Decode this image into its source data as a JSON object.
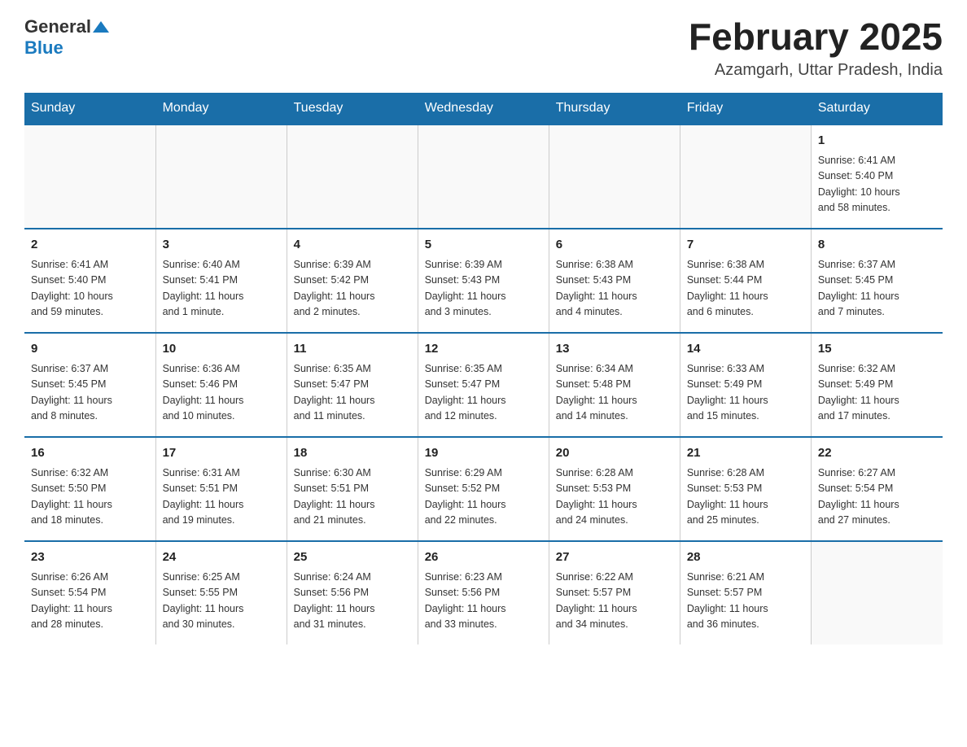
{
  "logo": {
    "general": "General",
    "blue": "Blue"
  },
  "title": "February 2025",
  "location": "Azamgarh, Uttar Pradesh, India",
  "days_of_week": [
    "Sunday",
    "Monday",
    "Tuesday",
    "Wednesday",
    "Thursday",
    "Friday",
    "Saturday"
  ],
  "weeks": [
    [
      {
        "day": "",
        "info": ""
      },
      {
        "day": "",
        "info": ""
      },
      {
        "day": "",
        "info": ""
      },
      {
        "day": "",
        "info": ""
      },
      {
        "day": "",
        "info": ""
      },
      {
        "day": "",
        "info": ""
      },
      {
        "day": "1",
        "info": "Sunrise: 6:41 AM\nSunset: 5:40 PM\nDaylight: 10 hours\nand 58 minutes."
      }
    ],
    [
      {
        "day": "2",
        "info": "Sunrise: 6:41 AM\nSunset: 5:40 PM\nDaylight: 10 hours\nand 59 minutes."
      },
      {
        "day": "3",
        "info": "Sunrise: 6:40 AM\nSunset: 5:41 PM\nDaylight: 11 hours\nand 1 minute."
      },
      {
        "day": "4",
        "info": "Sunrise: 6:39 AM\nSunset: 5:42 PM\nDaylight: 11 hours\nand 2 minutes."
      },
      {
        "day": "5",
        "info": "Sunrise: 6:39 AM\nSunset: 5:43 PM\nDaylight: 11 hours\nand 3 minutes."
      },
      {
        "day": "6",
        "info": "Sunrise: 6:38 AM\nSunset: 5:43 PM\nDaylight: 11 hours\nand 4 minutes."
      },
      {
        "day": "7",
        "info": "Sunrise: 6:38 AM\nSunset: 5:44 PM\nDaylight: 11 hours\nand 6 minutes."
      },
      {
        "day": "8",
        "info": "Sunrise: 6:37 AM\nSunset: 5:45 PM\nDaylight: 11 hours\nand 7 minutes."
      }
    ],
    [
      {
        "day": "9",
        "info": "Sunrise: 6:37 AM\nSunset: 5:45 PM\nDaylight: 11 hours\nand 8 minutes."
      },
      {
        "day": "10",
        "info": "Sunrise: 6:36 AM\nSunset: 5:46 PM\nDaylight: 11 hours\nand 10 minutes."
      },
      {
        "day": "11",
        "info": "Sunrise: 6:35 AM\nSunset: 5:47 PM\nDaylight: 11 hours\nand 11 minutes."
      },
      {
        "day": "12",
        "info": "Sunrise: 6:35 AM\nSunset: 5:47 PM\nDaylight: 11 hours\nand 12 minutes."
      },
      {
        "day": "13",
        "info": "Sunrise: 6:34 AM\nSunset: 5:48 PM\nDaylight: 11 hours\nand 14 minutes."
      },
      {
        "day": "14",
        "info": "Sunrise: 6:33 AM\nSunset: 5:49 PM\nDaylight: 11 hours\nand 15 minutes."
      },
      {
        "day": "15",
        "info": "Sunrise: 6:32 AM\nSunset: 5:49 PM\nDaylight: 11 hours\nand 17 minutes."
      }
    ],
    [
      {
        "day": "16",
        "info": "Sunrise: 6:32 AM\nSunset: 5:50 PM\nDaylight: 11 hours\nand 18 minutes."
      },
      {
        "day": "17",
        "info": "Sunrise: 6:31 AM\nSunset: 5:51 PM\nDaylight: 11 hours\nand 19 minutes."
      },
      {
        "day": "18",
        "info": "Sunrise: 6:30 AM\nSunset: 5:51 PM\nDaylight: 11 hours\nand 21 minutes."
      },
      {
        "day": "19",
        "info": "Sunrise: 6:29 AM\nSunset: 5:52 PM\nDaylight: 11 hours\nand 22 minutes."
      },
      {
        "day": "20",
        "info": "Sunrise: 6:28 AM\nSunset: 5:53 PM\nDaylight: 11 hours\nand 24 minutes."
      },
      {
        "day": "21",
        "info": "Sunrise: 6:28 AM\nSunset: 5:53 PM\nDaylight: 11 hours\nand 25 minutes."
      },
      {
        "day": "22",
        "info": "Sunrise: 6:27 AM\nSunset: 5:54 PM\nDaylight: 11 hours\nand 27 minutes."
      }
    ],
    [
      {
        "day": "23",
        "info": "Sunrise: 6:26 AM\nSunset: 5:54 PM\nDaylight: 11 hours\nand 28 minutes."
      },
      {
        "day": "24",
        "info": "Sunrise: 6:25 AM\nSunset: 5:55 PM\nDaylight: 11 hours\nand 30 minutes."
      },
      {
        "day": "25",
        "info": "Sunrise: 6:24 AM\nSunset: 5:56 PM\nDaylight: 11 hours\nand 31 minutes."
      },
      {
        "day": "26",
        "info": "Sunrise: 6:23 AM\nSunset: 5:56 PM\nDaylight: 11 hours\nand 33 minutes."
      },
      {
        "day": "27",
        "info": "Sunrise: 6:22 AM\nSunset: 5:57 PM\nDaylight: 11 hours\nand 34 minutes."
      },
      {
        "day": "28",
        "info": "Sunrise: 6:21 AM\nSunset: 5:57 PM\nDaylight: 11 hours\nand 36 minutes."
      },
      {
        "day": "",
        "info": ""
      }
    ]
  ]
}
